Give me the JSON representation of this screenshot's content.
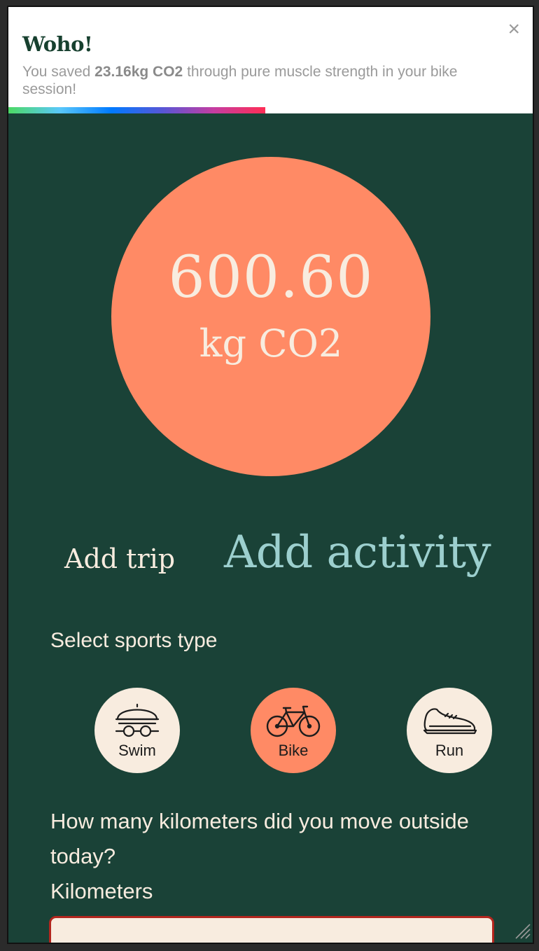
{
  "toast": {
    "title": "Woho!",
    "message_prefix": "You saved ",
    "message_bold": "23.16kg CO2",
    "message_suffix": " through pure muscle strength in your bike session!",
    "close_label": "×",
    "progress_fraction": 0.49
  },
  "total": {
    "value": "600.60",
    "unit": "kg CO2"
  },
  "tabs": {
    "trip": "Add trip",
    "activity": "Add activity"
  },
  "sports": {
    "label": "Select sports type",
    "items": [
      {
        "label": "Swim",
        "icon": "swim-cap-goggles-icon"
      },
      {
        "label": "Bike",
        "icon": "bicycle-icon",
        "selected": true
      },
      {
        "label": "Run",
        "icon": "running-shoe-icon"
      }
    ]
  },
  "form": {
    "question": "How many kilometers did you move outside today?",
    "km_label": "Kilometers",
    "km_value": ""
  },
  "colors": {
    "background": "#1a4237",
    "accent": "#ff8a65",
    "cream": "#f8ecdf",
    "teal": "#9ccfce"
  }
}
